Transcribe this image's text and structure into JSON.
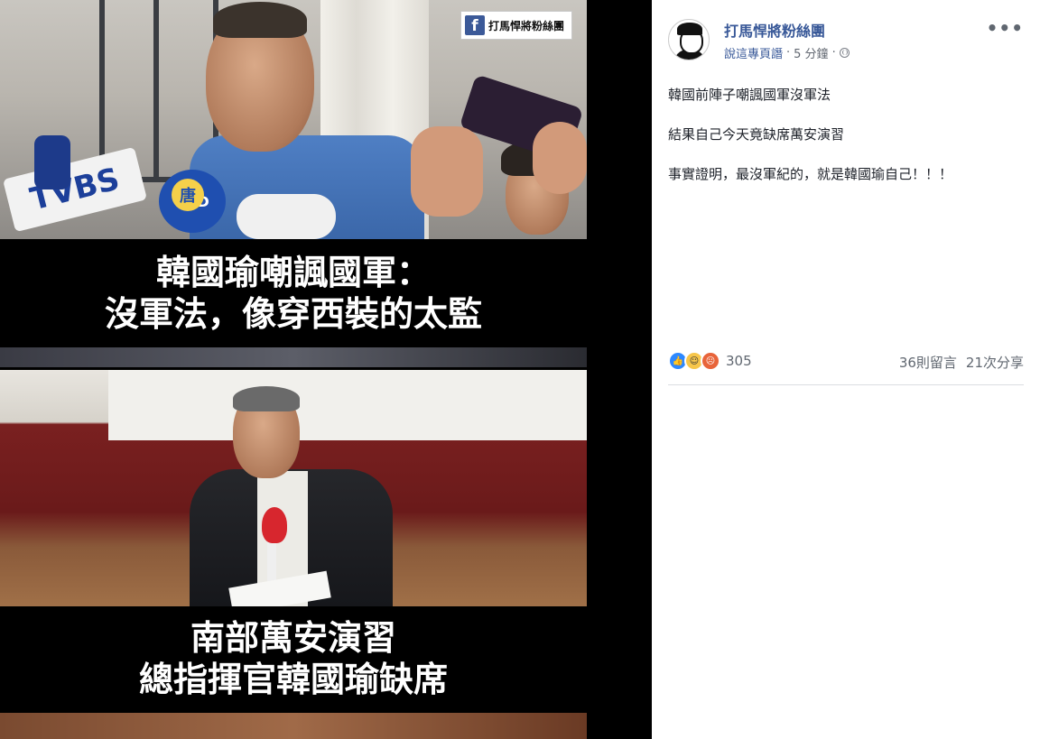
{
  "image": {
    "watermark_text": "打馬悍將粉絲團",
    "caption_top_line1": "韓國瑜嘲諷國軍：",
    "caption_top_line2": "沒軍法，像穿西裝的太監",
    "caption_bottom_line1": "南部萬安演習",
    "caption_bottom_line2": "總指揮官韓國瑜缺席",
    "mic_labels": [
      "TVBS",
      "NTD",
      "唐"
    ]
  },
  "post": {
    "page_name": "打馬悍將粉絲團",
    "meta_link": "說這專頁譖",
    "meta_sep1": "·",
    "time": "5 分鐘",
    "meta_sep2": "·",
    "more": "•••",
    "lines": [
      "韓國前陣子嘲諷國軍沒軍法",
      "結果自己今天竟缺席萬安演習",
      "事實證明，最沒軍紀的，就是韓國瑜自己！！！"
    ],
    "reaction_count": "305",
    "comments": "36則留言",
    "shares": "21次分享"
  },
  "colors": {
    "link": "#385898",
    "like": "#2d88ff",
    "haha": "#f7c64a",
    "angry": "#e8643a"
  }
}
